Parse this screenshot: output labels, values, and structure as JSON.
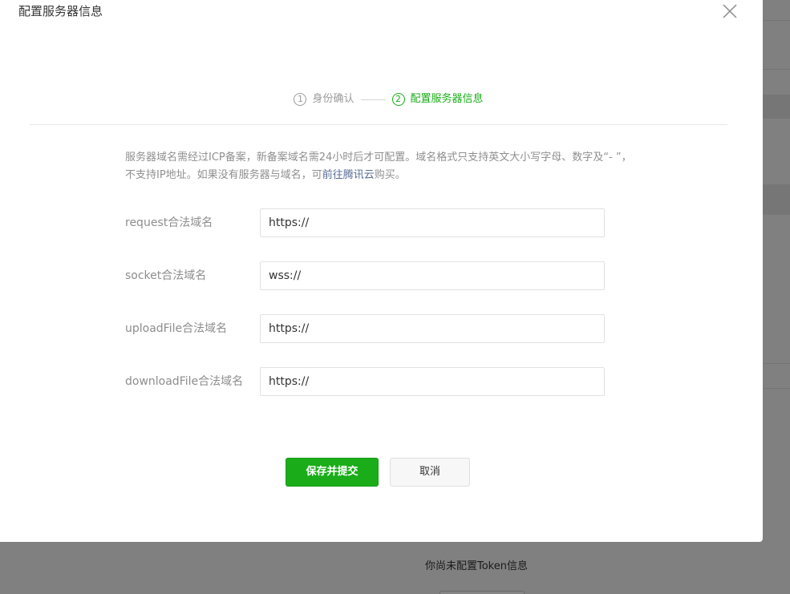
{
  "dialog": {
    "title": "配置服务器信息"
  },
  "steps": [
    {
      "num": "1",
      "label": "身份确认",
      "state": "done"
    },
    {
      "num": "2",
      "label": "配置服务器信息",
      "state": "active"
    }
  ],
  "notice": {
    "text_before": "服务器域名需经过ICP备案，新备案域名需24小时后才可配置。域名格式只支持英文大小写字母、数字及“- ”，不支持IP地址。如果没有服务器与域名，可",
    "link_text": "前往腾讯云",
    "text_after": "购买。"
  },
  "form": {
    "request": {
      "label": "request合法域名",
      "value": "https://"
    },
    "socket": {
      "label": "socket合法域名",
      "value": "wss://"
    },
    "upload": {
      "label": "uploadFile合法域名",
      "value": "https://"
    },
    "download": {
      "label": "downloadFile合法域名",
      "value": "https://"
    }
  },
  "buttons": {
    "submit": "保存并提交",
    "cancel": "取消"
  },
  "background": {
    "token_notice": "你尚未配置Token信息"
  },
  "colors": {
    "accent": "#1aad19",
    "link": "#576b95",
    "overlay": "#808080"
  }
}
